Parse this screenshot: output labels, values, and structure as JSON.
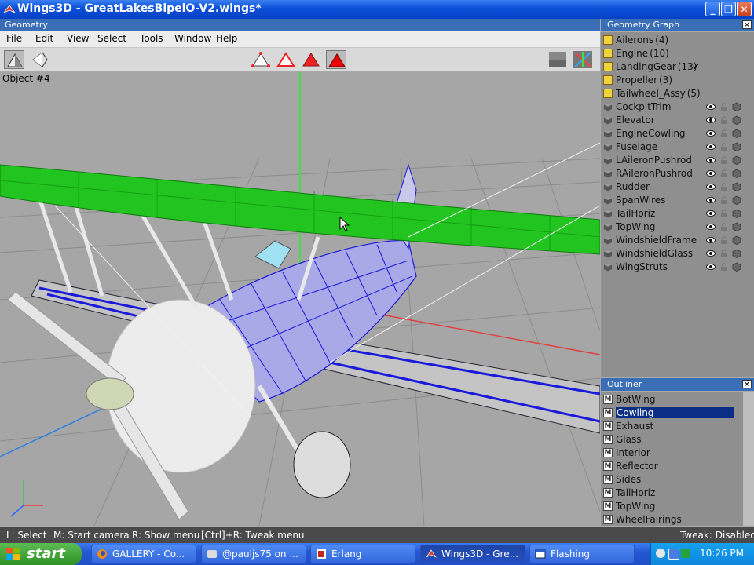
{
  "window": {
    "title": "Wings3D - GreatLakesBipelO-V2.wings*",
    "controls": [
      "_",
      "❐",
      "✕"
    ]
  },
  "geometry": {
    "header": "Geometry",
    "menu": [
      "File",
      "Edit",
      "View",
      "Select",
      "Tools",
      "Window",
      "Help"
    ],
    "object_label": "Object #4"
  },
  "geometry_graph": {
    "header": "Geometry Graph",
    "folders": [
      {
        "name": "Ailerons",
        "count": "(4)"
      },
      {
        "name": "Engine",
        "count": "(10)"
      },
      {
        "name": "LandingGear",
        "count": "(13)",
        "checked": "✔"
      },
      {
        "name": "Propeller",
        "count": "(3)"
      },
      {
        "name": "Tailwheel_Assy",
        "count": "(5)"
      }
    ],
    "objects": [
      "CockpitTrim",
      "Elevator",
      "EngineCowling",
      "Fuselage",
      "LAileronPushrod",
      "RAileronPushrod",
      "Rudder",
      "SpanWires",
      "TailHoriz",
      "TopWing",
      "WindshieldFrame",
      "WindshieldGlass",
      "WingStruts"
    ]
  },
  "outliner": {
    "header": "Outliner",
    "items": [
      "BotWing",
      "Cowling",
      "Exhaust",
      "Glass",
      "Interior",
      "Reflector",
      "Sides",
      "TailHoriz",
      "TopWing",
      "WheelFairings"
    ],
    "selected": "Cowling",
    "icon_letter": "M"
  },
  "status": {
    "select": "L: Select",
    "camera": "M: Start camera",
    "show_menu": "R: Show menu",
    "tweak_menu": "[Ctrl]+R: Tweak menu",
    "tweak_state": "Tweak: Disabled"
  },
  "taskbar": {
    "start": "start",
    "tasks": [
      {
        "label": "GALLERY - Co...",
        "icon": "firefox-icon"
      },
      {
        "label": "@pauljs75 on ...",
        "icon": "chat-icon"
      },
      {
        "label": "Erlang",
        "icon": "erlang-icon"
      },
      {
        "label": "Wings3D - Gre...",
        "icon": "wings3d-icon",
        "active": true
      },
      {
        "label": "Flashing",
        "icon": "window-icon"
      }
    ],
    "clock": "10:26 PM"
  },
  "colors": {
    "selection_green": "#22c51f",
    "accent_blue": "#3a6fb8"
  }
}
